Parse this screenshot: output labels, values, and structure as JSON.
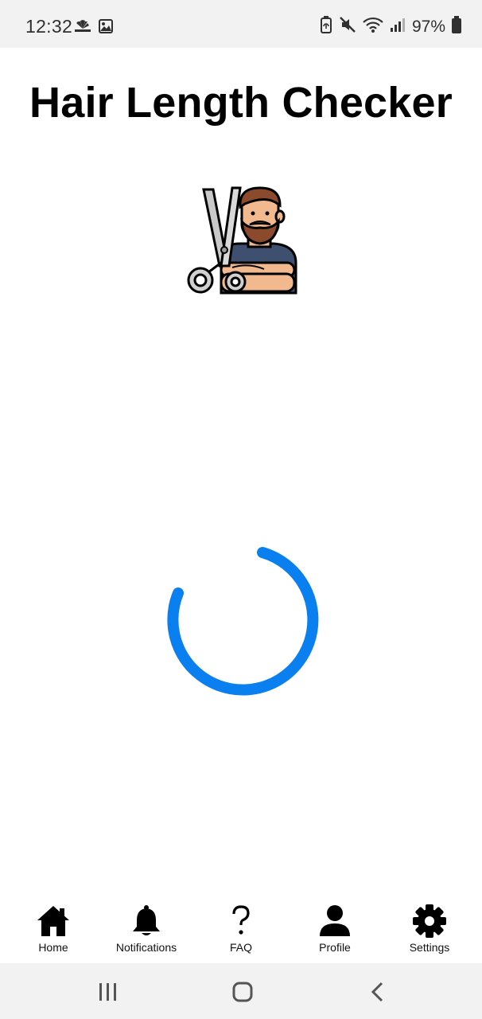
{
  "status_bar": {
    "time": "12:32",
    "battery": "97%",
    "icons_left": [
      "cnbc-icon",
      "gallery-icon"
    ],
    "icons_right": [
      "battery-saver-icon",
      "mute-icon",
      "wifi-icon",
      "signal-icon",
      "battery-icon"
    ]
  },
  "app": {
    "title": "Hair Length Checker",
    "logo_icon": "barber-with-scissors-icon",
    "loading": true,
    "accent_color": "#0a7ff0"
  },
  "bottom_nav": {
    "items": [
      {
        "label": "Home",
        "icon": "home-icon"
      },
      {
        "label": "Notifications",
        "icon": "bell-icon"
      },
      {
        "label": "FAQ",
        "icon": "question-icon"
      },
      {
        "label": "Profile",
        "icon": "person-icon"
      },
      {
        "label": "Settings",
        "icon": "gear-icon"
      }
    ]
  },
  "system_nav": {
    "buttons": [
      "recents-button",
      "home-button",
      "back-button"
    ]
  }
}
